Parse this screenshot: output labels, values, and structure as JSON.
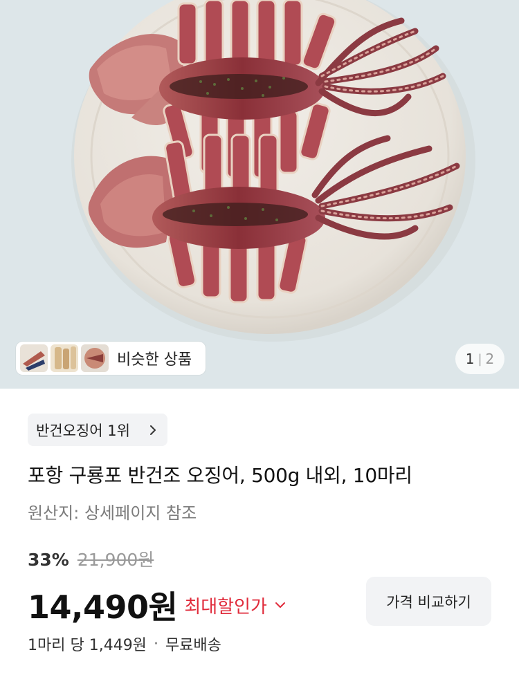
{
  "gallery": {
    "image_alt": "grilled dried squid on a plate",
    "similar_products_label": "비슷한 상품",
    "page_current": "1",
    "page_separator": "|",
    "page_total": "2"
  },
  "product": {
    "rank_badge": "반건오징어 1위",
    "title": "포항 구룡포 반건조 오징어, 500g 내외, 10마리",
    "origin": "원산지: 상세페이지 참조",
    "discount_rate": "33%",
    "original_price": "21,900원",
    "sale_price": "14,490원",
    "max_discount_label": "최대할인가",
    "compare_button_label": "가격 비교하기",
    "unit_price": "1마리 당 1,449원",
    "unit_separator": "·",
    "shipping": "무료배송"
  },
  "colors": {
    "discount_accent": "#e02b3b",
    "chip_bg": "#f2f3f5",
    "hero_bg": "#dde7ea"
  },
  "icons": {
    "rank_chevron": "chevron-right-icon",
    "discount_chevron": "chevron-down-icon"
  }
}
